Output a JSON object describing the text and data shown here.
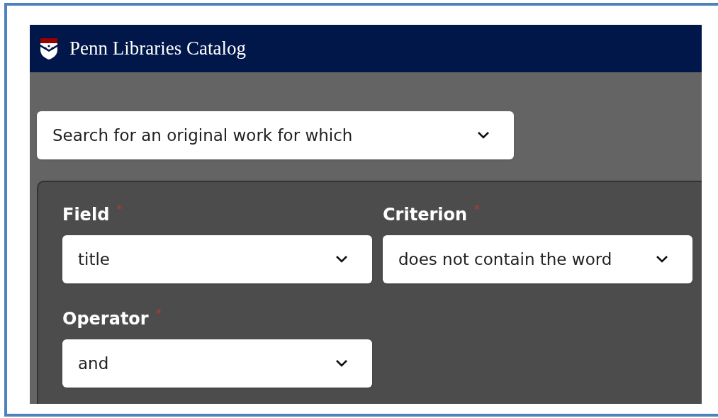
{
  "header": {
    "title": "Penn Libraries Catalog"
  },
  "search_type": {
    "value": "Search for an original work for which"
  },
  "fields": [
    {
      "label": "Field",
      "required_mark": "*",
      "value": "title"
    },
    {
      "label": "Criterion",
      "required_mark": "*",
      "value": "does not contain the word"
    },
    {
      "label": "Operator",
      "required_mark": "*",
      "value": "and"
    }
  ]
}
